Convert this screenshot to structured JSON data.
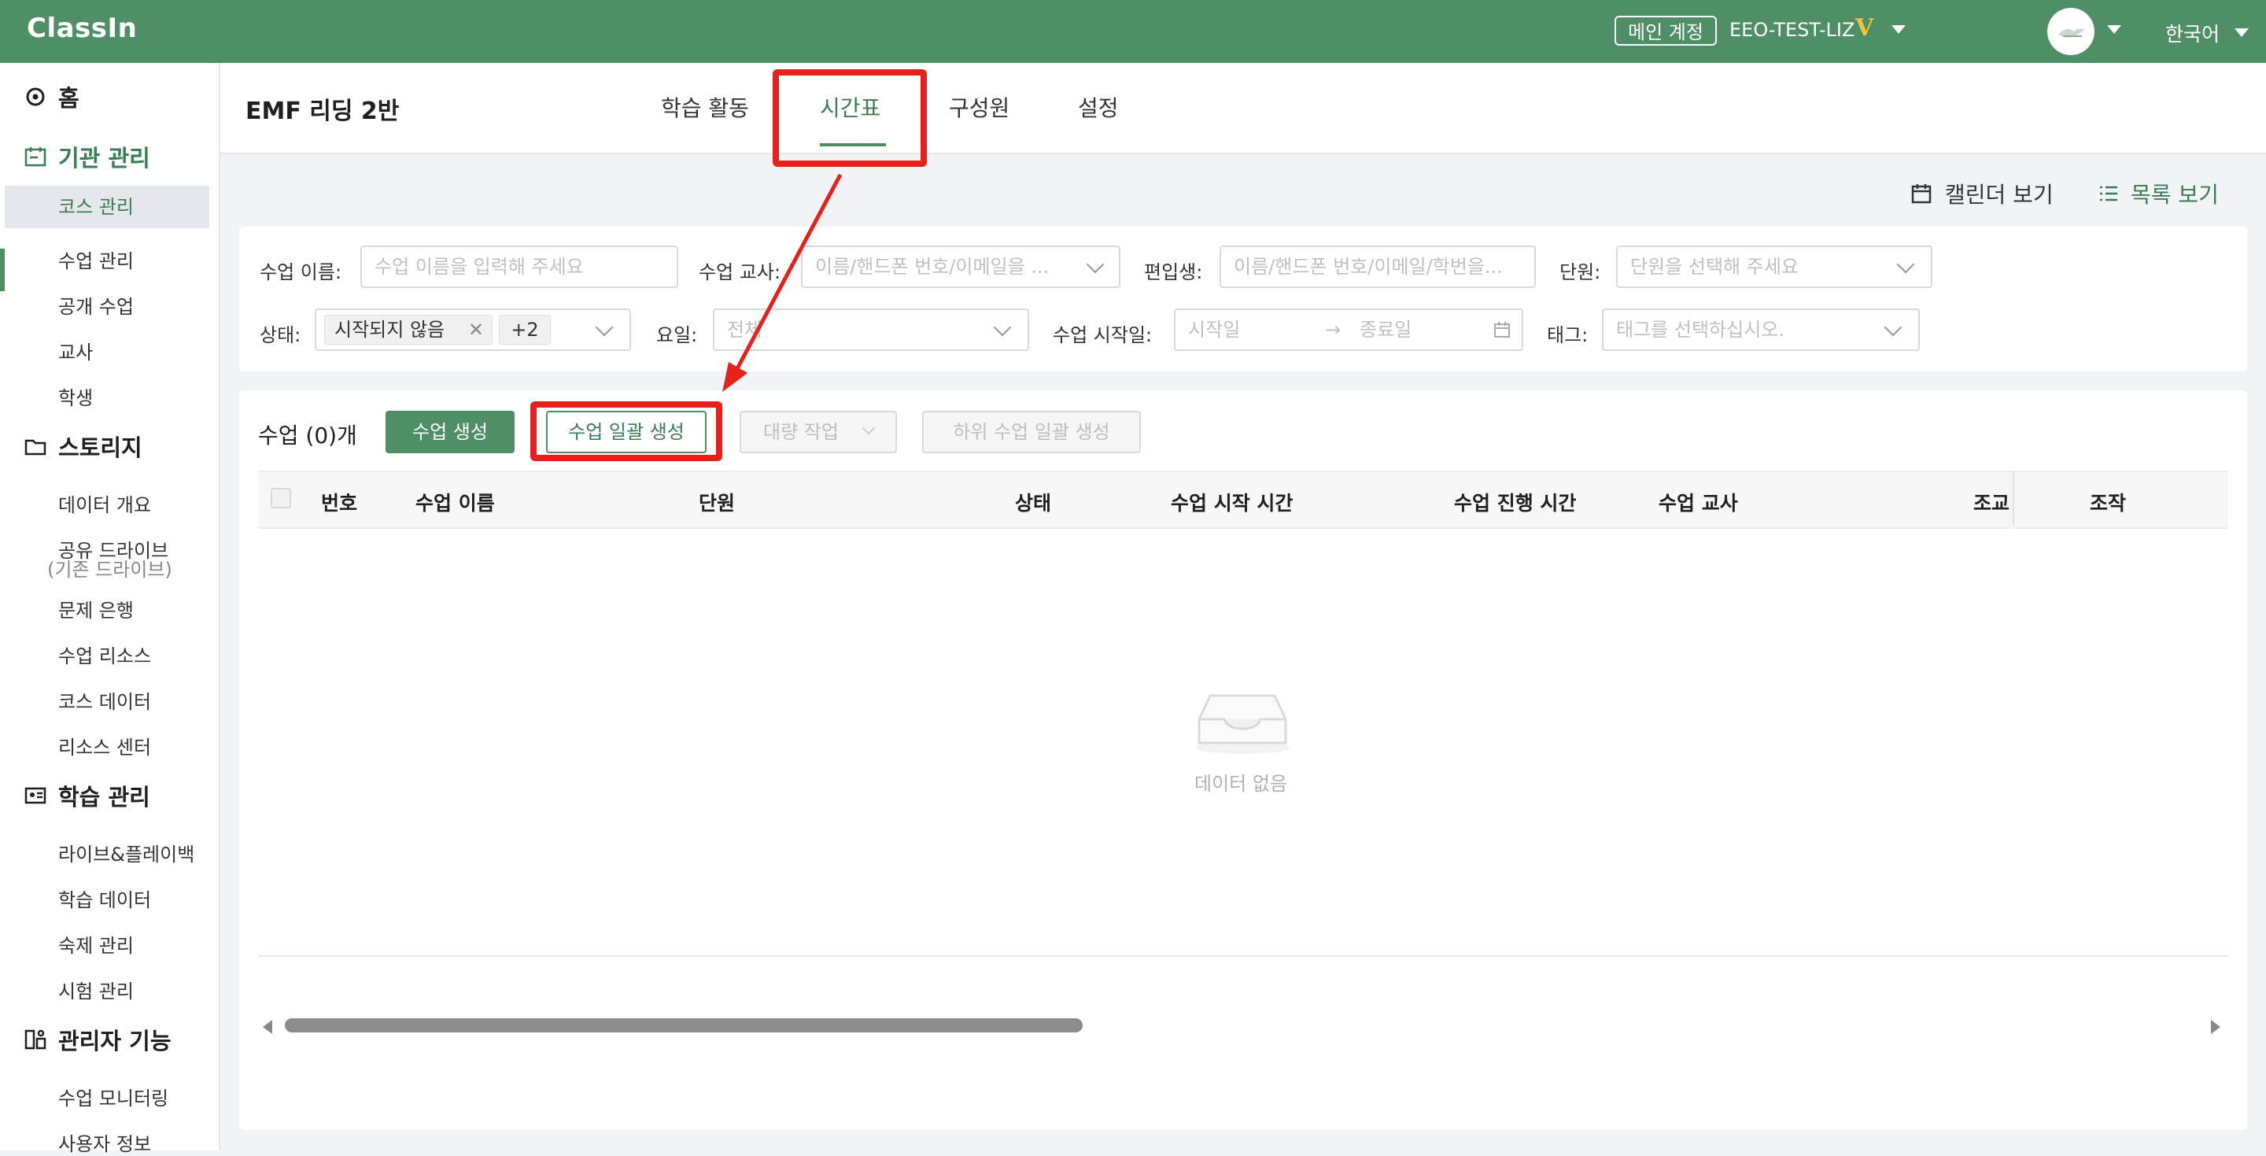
{
  "app": {
    "logo": "ClassIn",
    "account_badge": "메인 계정",
    "account_name": "EEO-TEST-LIZ",
    "vip_mark": "V",
    "language": "한국어",
    "brand_color": "#4f8f66",
    "highlight_color": "#e8201a"
  },
  "sidebar": {
    "home": "홈",
    "org_section": "기관 관리",
    "org_items": [
      "코스 관리",
      "수업 관리",
      "공개 수업",
      "교사",
      "학생"
    ],
    "storage_section": "스토리지",
    "storage_items": [
      "데이터 개요",
      "공유 드라이브",
      "(기존 드라이브)",
      "문제 은행",
      "수업 리소스",
      "코스 데이터",
      "리소스 센터"
    ],
    "learning_section": "학습 관리",
    "learning_items": [
      "라이브&플레이백",
      "학습 데이터",
      "숙제 관리",
      "시험 관리"
    ],
    "admin_section": "관리자 기능",
    "admin_items": [
      "수업 모니터링",
      "사용자 정보"
    ]
  },
  "header": {
    "course_title": "EMF 리딩 2반",
    "tabs": [
      "학습 활동",
      "시간표",
      "구성원",
      "설정"
    ],
    "active_tab": "시간표"
  },
  "view": {
    "calendar": "캘린더 보기",
    "list": "목록 보기"
  },
  "filters": {
    "lesson_name_label": "수업 이름:",
    "lesson_name_placeholder": "수업 이름을 입력해 주세요",
    "teacher_label": "수업 교사:",
    "teacher_placeholder": "이름/핸드폰 번호/이메일을 ...",
    "transfer_label": "편입생:",
    "transfer_placeholder": "이름/핸드폰 번호/이메일/학번을...",
    "unit_label": "단원:",
    "unit_placeholder": "단원을 선택해 주세요",
    "status_label": "상태:",
    "status_chip": "시작되지 않음",
    "status_more": "+2",
    "weekday_label": "요일:",
    "weekday_value": "전체",
    "start_date_label": "수업 시작일:",
    "start_placeholder": "시작일",
    "date_arrow": "→",
    "end_placeholder": "종료일",
    "tag_label": "태그:",
    "tag_placeholder": "태그를 선택하십시오."
  },
  "actions": {
    "count_label": "수업 (0)개",
    "create": "수업 생성",
    "bulk_create": "수업 일괄 생성",
    "bulk_action": "대량 작업",
    "sub_bulk_create": "하위 수업 일괄 생성"
  },
  "table": {
    "columns": [
      "번호",
      "수업 이름",
      "단원",
      "상태",
      "수업 시작 시간",
      "수업 진행 시간",
      "수업 교사",
      "조교",
      "조작"
    ],
    "empty_text": "데이터 없음"
  }
}
